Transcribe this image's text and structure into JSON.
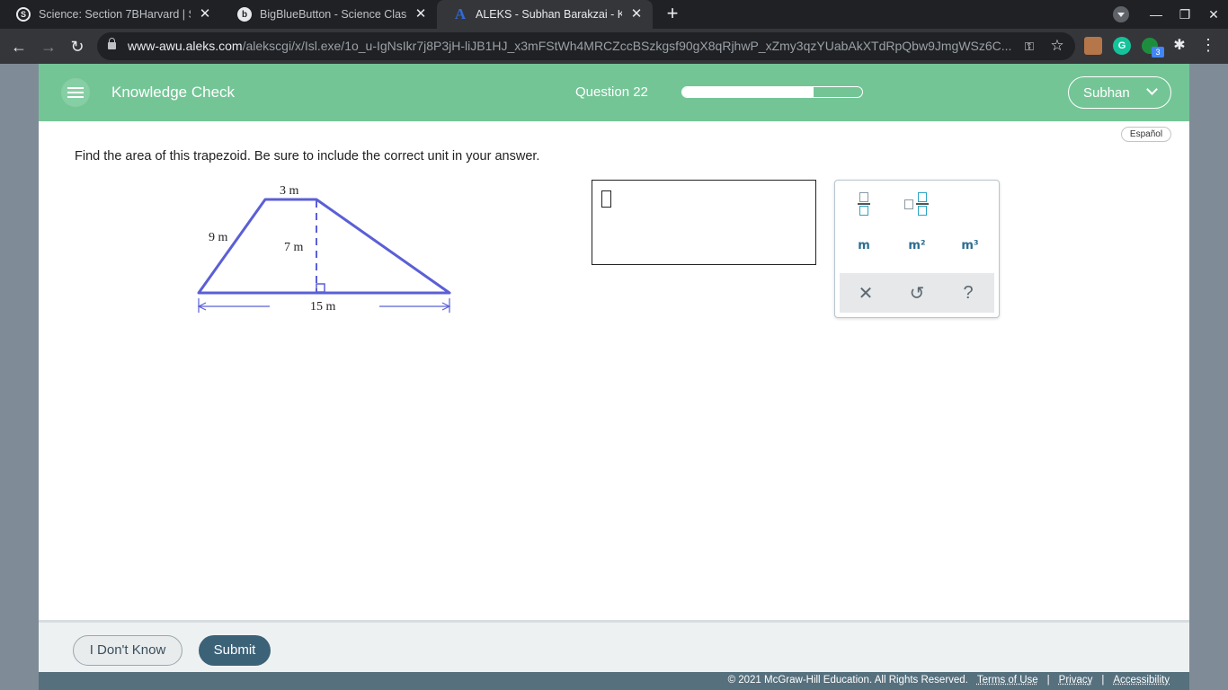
{
  "browser": {
    "tabs": [
      {
        "title": "Science: Section 7BHarvard | Sc",
        "favicon": "schoology-icon"
      },
      {
        "title": "BigBlueButton - Science Class (3",
        "favicon": "bigbluebutton-icon"
      },
      {
        "title": "ALEKS - Subhan Barakzai - Know",
        "favicon": "aleks-icon"
      }
    ],
    "url_host": "www-awu.aleks.com",
    "url_path": "/alekscgi/x/Isl.exe/1o_u-IgNsIkr7j8P3jH-liJB1HJ_x3mFStWh4MRCZccBSzkgsf90gX8qRjhwP_xZmy3qzYUabAkXTdRpQbw9JmgWSz6C...",
    "extension_badge": "3"
  },
  "header": {
    "title": "Knowledge Check",
    "question_label": "Question 22",
    "progress_fraction": 0.73,
    "user_name": "Subhan",
    "accent_color": "#74c596"
  },
  "language_button": "Español",
  "question": {
    "prompt": "Find the area of this trapezoid. Be sure to include the correct unit in your answer.",
    "figure_labels": {
      "top": "3 m",
      "left_side": "9 m",
      "height": "7 m",
      "base": "15 m"
    }
  },
  "palette": {
    "units": [
      "m",
      "m²",
      "m³"
    ]
  },
  "footer": {
    "dont_know_label": "I Don't Know",
    "submit_label": "Submit",
    "copyright": "© 2021 McGraw-Hill Education. All Rights Reserved.",
    "links": [
      "Terms of Use",
      "Privacy",
      "Accessibility"
    ]
  }
}
